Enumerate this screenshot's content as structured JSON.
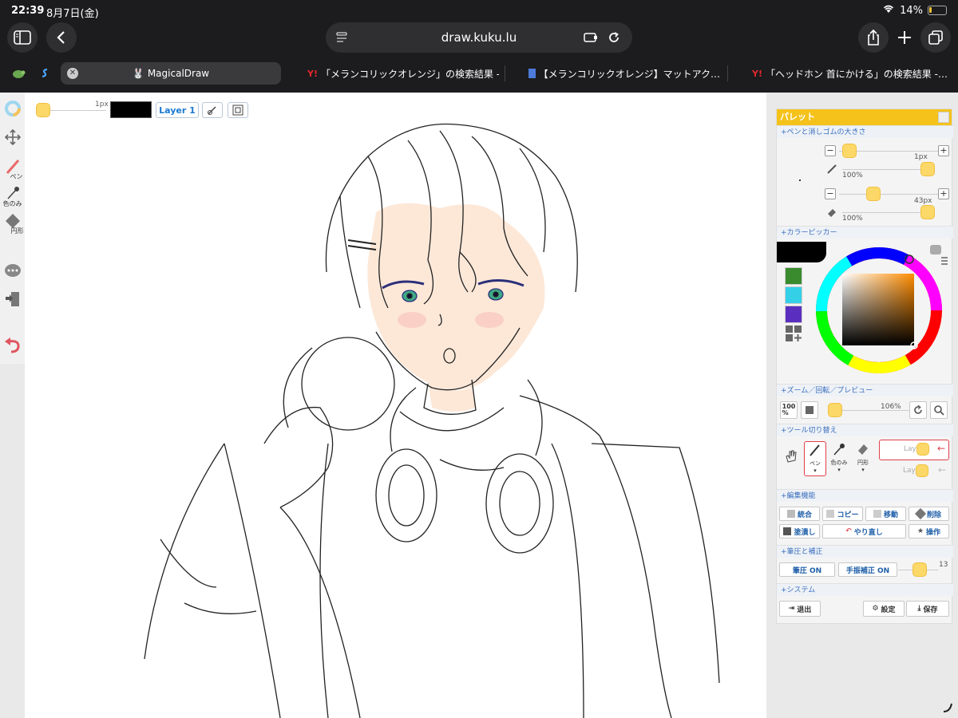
{
  "status_bar": {
    "time": "22:39",
    "date": "8月7日(金)",
    "battery": "14%"
  },
  "browser": {
    "url": "draw.kuku.lu",
    "tabs": [
      {
        "label": "MagicalDraw",
        "active": true
      },
      {
        "label": "「メランコリックオレンジ」の検索結果 -…",
        "favicon": "Y!"
      },
      {
        "label": "【メランコリックオレンジ】マットアク…"
      },
      {
        "label": "「ヘッドホン 首にかける」の検索結果 -…",
        "favicon": "Y!"
      }
    ]
  },
  "left_tools": {
    "pen_label": "ペン",
    "eyedropper_label": "色のみ",
    "shape_label": "円形"
  },
  "top_bar": {
    "brush_size": "1px",
    "layer_button": "Layer 1",
    "current_color": "#000000"
  },
  "palette": {
    "title": "パレット",
    "sections": {
      "brush_size": "+ペンと消しゴムの大きさ",
      "color_picker": "+カラーピッカー",
      "zoom": "+ズーム／回転／プレビュー",
      "tool_switch": "+ツール切り替え",
      "edit": "+編集機能",
      "pressure": "+筆圧と補正",
      "system": "+システム"
    },
    "pen": {
      "size": "1px",
      "opacity": "100%"
    },
    "eraser": {
      "size": "43px",
      "opacity": "100%"
    },
    "swatches": [
      "#3a8a2e",
      "#33d0e8",
      "#5a2fc0"
    ],
    "zoom": {
      "reset_label": "100\n%",
      "value": "106%"
    },
    "tools": {
      "pen": "ペン",
      "eyedropper": "色のみ",
      "shape": "円形"
    },
    "layers": [
      "Layer1",
      "Layer2"
    ],
    "edit_buttons": {
      "merge": "統合",
      "copy": "コピー",
      "move": "移動",
      "delete": "削除",
      "fill": "塗潰し",
      "redo": "やり直し",
      "operate": "操作"
    },
    "pressure": {
      "pressure_btn": "筆圧 ON",
      "stabilizer_btn": "手振補正 ON",
      "value": "13"
    },
    "system": {
      "exit": "退出",
      "settings": "設定",
      "save": "保存"
    }
  },
  "colors": {
    "accent": "#f4c21b",
    "knob": "#fcd868",
    "link_blue": "#1a7ad0",
    "layer_red": "#e0404a"
  }
}
